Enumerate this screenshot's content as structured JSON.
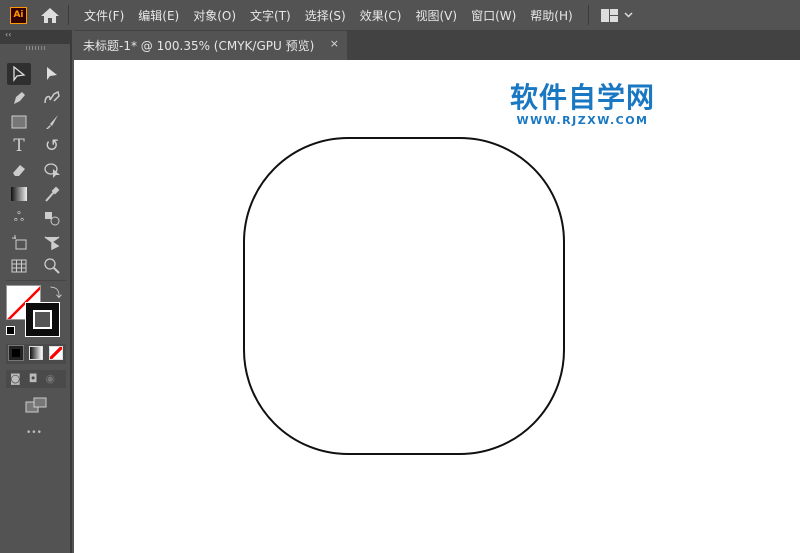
{
  "app": {
    "logo": "Ai",
    "home_icon": "home-icon",
    "workspace_icon": "workspace-layout-icon"
  },
  "menu": [
    "文件(F)",
    "编辑(E)",
    "对象(O)",
    "文字(T)",
    "选择(S)",
    "效果(C)",
    "视图(V)",
    "窗口(W)",
    "帮助(H)"
  ],
  "tab": {
    "title": "未标题-1* @ 100.35% (CMYK/GPU 预览)",
    "close": "×"
  },
  "toolbar": {
    "collapse": "‹‹",
    "more": "•••"
  },
  "watermark": {
    "title": "软件自学网",
    "url": "WWW.RJZXW.COM"
  },
  "colors": {
    "accent": "#ff9a00",
    "watermark": "#1a78c2",
    "stroke": "#111111"
  }
}
